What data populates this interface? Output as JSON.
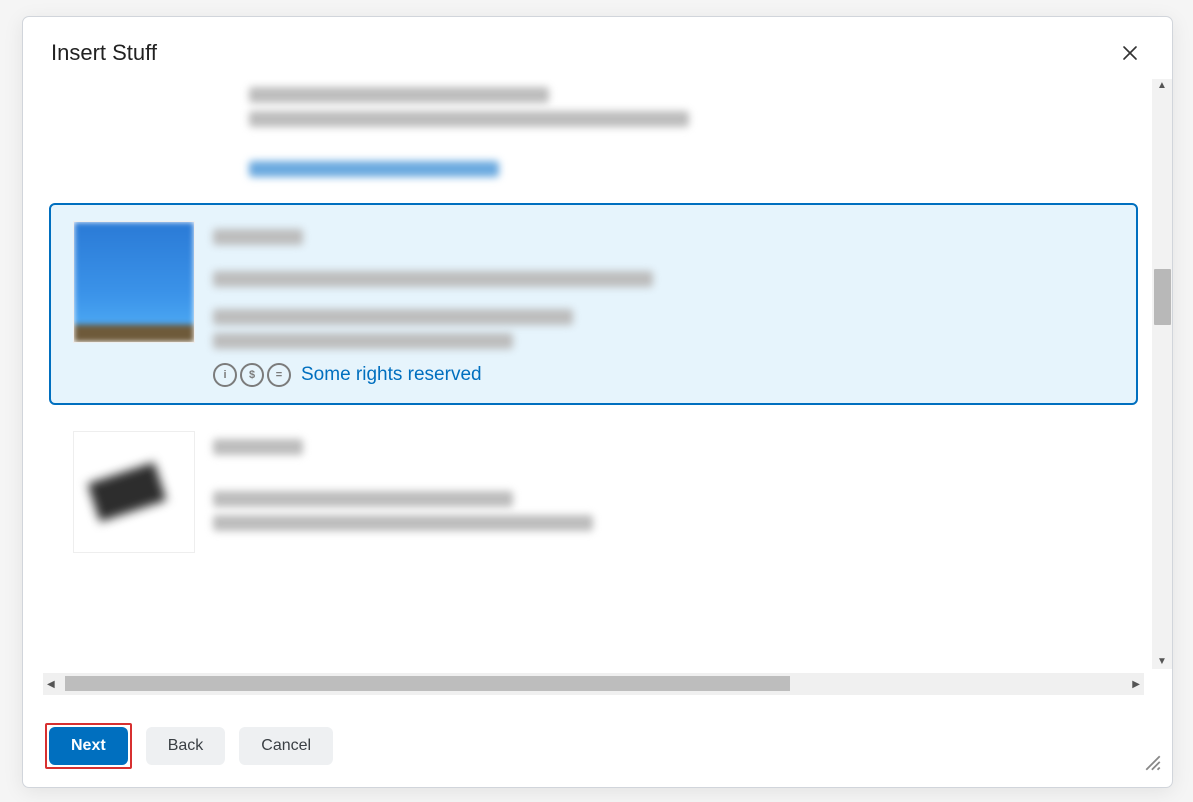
{
  "dialog": {
    "title": "Insert Stuff"
  },
  "results": {
    "top_item": {
      "lines": [
        "",
        ""
      ],
      "link": ""
    },
    "selected_item": {
      "rights_link": "Some rights reserved"
    }
  },
  "buttons": {
    "next": "Next",
    "back": "Back",
    "cancel": "Cancel"
  }
}
